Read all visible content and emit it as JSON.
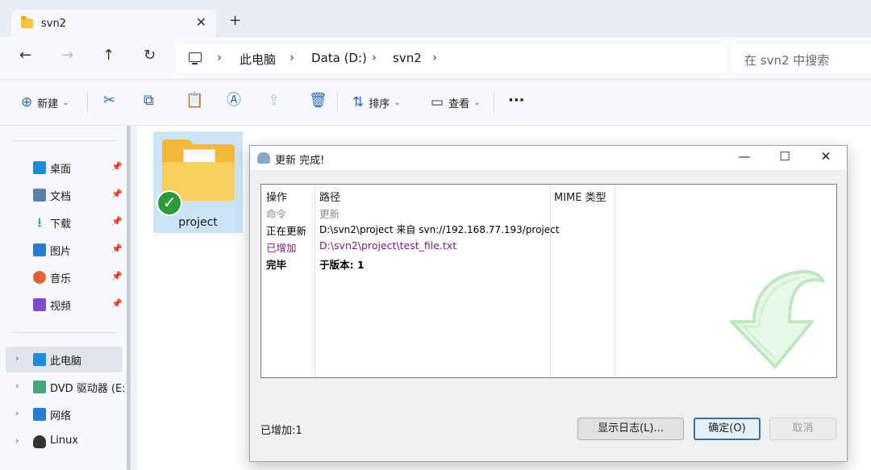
{
  "tab": {
    "label": "svn2",
    "close": "✕",
    "new_tab": "+"
  },
  "nav": {
    "back": "←",
    "forward": "→",
    "up": "↑",
    "refresh": "↻"
  },
  "breadcrumb": {
    "items": [
      "此电脑",
      "Data (D:)",
      "svn2"
    ],
    "sep": "›"
  },
  "search": {
    "placeholder": "在 svn2 中搜索"
  },
  "toolbar": {
    "new_label": "新建",
    "sort_label": "排序",
    "view_label": "查看",
    "more": "···"
  },
  "sidebar": {
    "pinned": [
      {
        "label": "桌面",
        "icon": "desktop-icon",
        "color": "#1f8dd6"
      },
      {
        "label": "文档",
        "icon": "document-icon",
        "color": "#5b7fa6"
      },
      {
        "label": "下载",
        "icon": "download-icon",
        "color": "#2d9c4f"
      },
      {
        "label": "图片",
        "icon": "pictures-icon",
        "color": "#2b7bd4"
      },
      {
        "label": "音乐",
        "icon": "music-icon",
        "color": "#e0623a"
      },
      {
        "label": "视频",
        "icon": "video-icon",
        "color": "#7b4bd1"
      }
    ],
    "drives": [
      {
        "label": "此电脑",
        "icon": "this-pc-icon",
        "color": "#1f8dd6"
      },
      {
        "label": "DVD 驱动器 (E:)",
        "icon": "dvd-drive-icon",
        "color": "#4aa37a"
      },
      {
        "label": "网络",
        "icon": "network-icon",
        "color": "#2b7bd4"
      },
      {
        "label": "Linux",
        "icon": "linux-icon",
        "color": "#333333"
      }
    ]
  },
  "content": {
    "folder_label": "project"
  },
  "dialog": {
    "title": "更新 完成!",
    "columns": {
      "action": "操作",
      "path": "路径",
      "mime": "MIME 类型"
    },
    "rows": [
      {
        "action": "命令",
        "path": "更新",
        "style": "gray"
      },
      {
        "action": "正在更新",
        "path": "D:\\svn2\\project 来自 svn://192.168.77.193/project",
        "style": "black"
      },
      {
        "action": "已增加",
        "path": "D:\\svn2\\project\\test_file.txt",
        "style": "purple"
      },
      {
        "action": "完毕",
        "path": "于版本: 1",
        "style": "bold"
      }
    ],
    "status": "已增加:1",
    "buttons": {
      "show_log": "显示日志(L)...",
      "ok": "确定(O)",
      "cancel": "取消"
    }
  }
}
